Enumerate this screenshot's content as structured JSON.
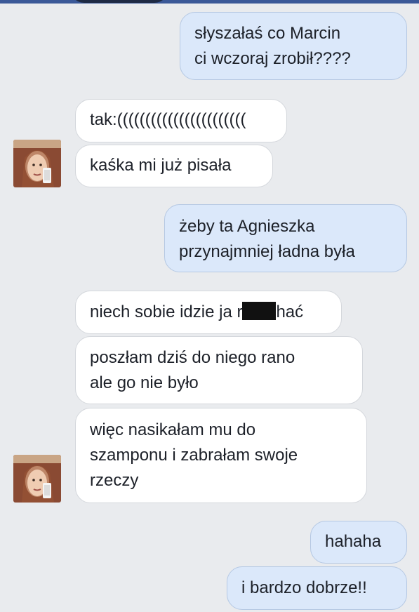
{
  "chat": {
    "colors": {
      "outgoing_bubble": "#dbe8fa",
      "incoming_bubble": "#ffffff",
      "background": "#e9ebee"
    },
    "messages": [
      {
        "side": "outgoing",
        "lines": [
          "słyszałaś co Marcin",
          "ci wczoraj zrobił????"
        ]
      },
      {
        "side": "incoming",
        "lines": [
          "tak:((((((((((((((((((((((("
        ]
      },
      {
        "side": "incoming",
        "lines": [
          "kaśka mi już pisała"
        ]
      },
      {
        "side": "outgoing",
        "lines": [
          "żeby ta Agnieszka",
          "przynajmniej ładna była"
        ]
      },
      {
        "side": "incoming",
        "lines": [
          "niech sobie idzie ja r",
          "hać"
        ],
        "censored": true
      },
      {
        "side": "incoming",
        "lines": [
          "poszłam dziś do niego rano",
          "ale go nie było"
        ]
      },
      {
        "side": "incoming",
        "lines": [
          "więc nasikałam mu do",
          "szamponu i zabrałam swoje",
          "rzeczy"
        ]
      },
      {
        "side": "outgoing",
        "lines": [
          "hahaha"
        ]
      },
      {
        "side": "outgoing",
        "lines": [
          "i bardzo dobrze!!"
        ]
      }
    ],
    "avatar_icon": "user-photo-icon"
  }
}
